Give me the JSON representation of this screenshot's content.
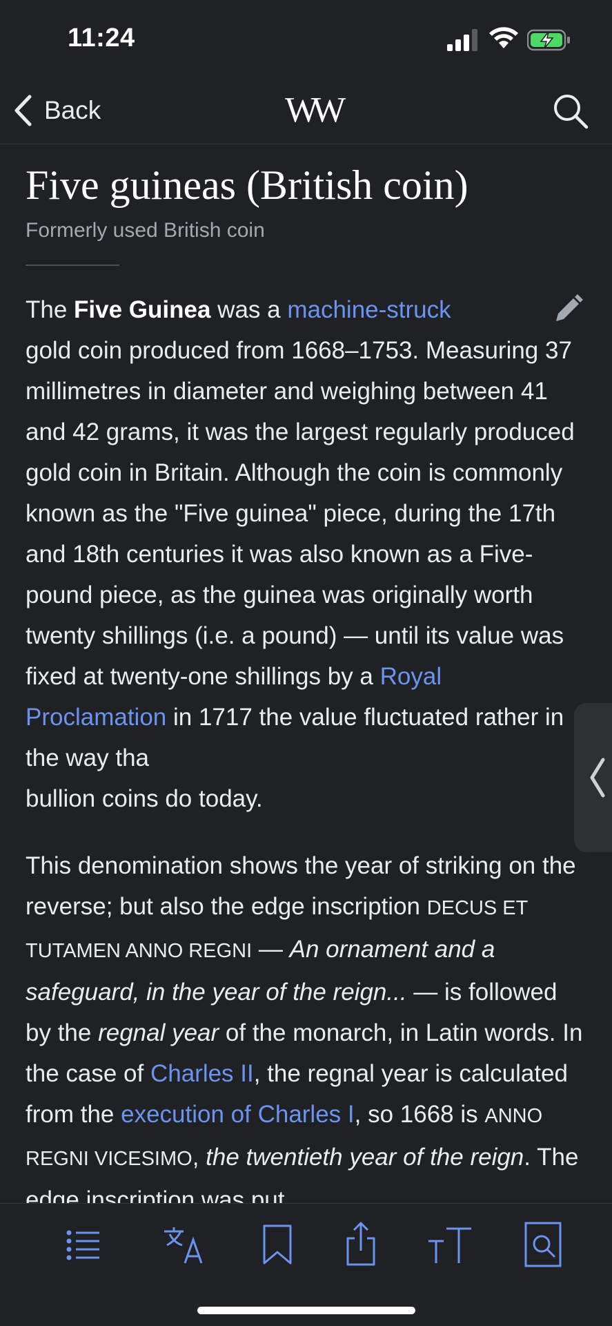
{
  "status_bar": {
    "time": "11:24",
    "icons": [
      "signal-icon",
      "wifi-icon",
      "battery-charging-icon"
    ]
  },
  "nav": {
    "back_label": "Back",
    "logo_text": "W"
  },
  "article": {
    "title": "Five guineas (British coin)",
    "description": "Formerly used British coin",
    "p1": {
      "t1": "The ",
      "b1": "Five Guinea",
      "t2": " was a ",
      "link1": "machine-struck",
      "t3": " gold coin produced from 1668–1753. Measuring 37 millimetres in diameter and weighing between 41 and 42 grams, it was the largest regularly produced gold coin in Britain. Although the coin is commonly known as the \"Five guinea\" piece, during the 17th and 18th centuries it was also known as a Five-pound piece, as the guinea was originally worth twenty shillings (i.e. a pound) — until its value was fixed at twenty-one shillings by a ",
      "link2": "Royal Proclamation",
      "t4": " in 1717 the value fluctuated rather in the way tha",
      "t5": " bullion coins do today."
    },
    "p2": {
      "t1": "This denomination shows the year of striking on the reverse; but also the edge inscription ",
      "sc1": "DECUS ET TUTAMEN ANNO REGNI",
      "t2": " — ",
      "i1": "An ornament and a safeguard, in the year of the reign...",
      "t3": " — is followed by the ",
      "i2": "regnal year",
      "t4": " of the monarch, in Latin words. In the case of ",
      "link1": "Charles II",
      "t5": ", the regnal year is calculated from the ",
      "link2": "execution of Charles I",
      "t6": ", so 1668 is ",
      "sc2": "ANNO REGNI VICESIMO",
      "t7": ", ",
      "i3": "the twentieth year of the reign",
      "t8": ". The edge inscription was put"
    }
  },
  "toolbar": {
    "items": [
      "contents-icon",
      "language-icon",
      "bookmark-icon",
      "share-icon",
      "text-size-icon",
      "find-in-page-icon"
    ]
  },
  "colors": {
    "background": "#202124",
    "text": "#eaecf0",
    "link": "#6b93f0",
    "icon": "#6b93f0"
  }
}
